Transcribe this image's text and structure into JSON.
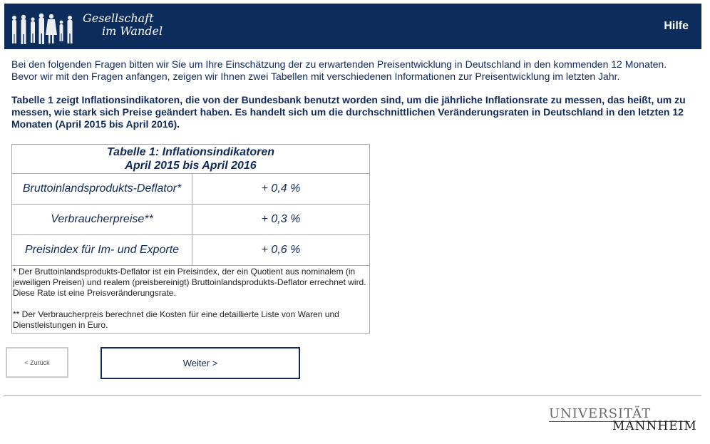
{
  "header": {
    "logo_line1": "Gesellschaft",
    "logo_line2": "im Wandel",
    "help_label": "Hilfe",
    "bg_color": "#0c2c5c"
  },
  "intro": {
    "line1": "Bei den folgenden Fragen bitten wir Sie um Ihre Einschätzung der zu erwartenden Preisentwicklung in Deutschland in den kommenden 12 Monaten.",
    "line2": "Bevor wir mit den Fragen anfangen, zeigen wir Ihnen zwei Tabellen mit verschiedenen Informationen zur Preisentwicklung im letzten Jahr."
  },
  "description": "Tabelle 1 zeigt Inflationsindikatoren, die von der Bundesbank benutzt worden sind, um die jährliche Inflationsrate zu messen, das heißt, um zu messen, wie stark sich Preise geändert haben. Es handelt sich um die durchschnittlichen Veränderungsraten in Deutschland in den letzten 12 Monaten (April 2015 bis April 2016).",
  "table": {
    "title_line1": "Tabelle 1: Inflationsindikatoren",
    "title_line2": "April 2015 bis April 2016",
    "rows": [
      {
        "label": "Bruttoinlandsprodukts-Deflator*",
        "value": "+ 0,4 %"
      },
      {
        "label": "Verbraucherpreise**",
        "value": "+ 0,3 %"
      },
      {
        "label": "Preisindex für Im- und Exporte",
        "value": "+ 0,6 %"
      }
    ],
    "note1": "* Der Bruttoinlandsprodukts-Deflator ist ein Preisindex, der ein Quotient aus nominalem (in jeweiligen Preisen) und realem (preisbereinigt) Bruttoinlandsprodukts-Deflator errechnet wird. Diese Rate ist eine Preisveränderungsrate.",
    "note2": "** Der Verbraucherpreis berechnet die Kosten für eine detaillierte Liste von Waren und Dienstleistungen in Euro."
  },
  "nav": {
    "back_label": "< Zurück",
    "next_label": "Weiter >"
  },
  "footer": {
    "uni_line1": "UNIVERSITÄT",
    "uni_line2": "MANNHEIM"
  }
}
